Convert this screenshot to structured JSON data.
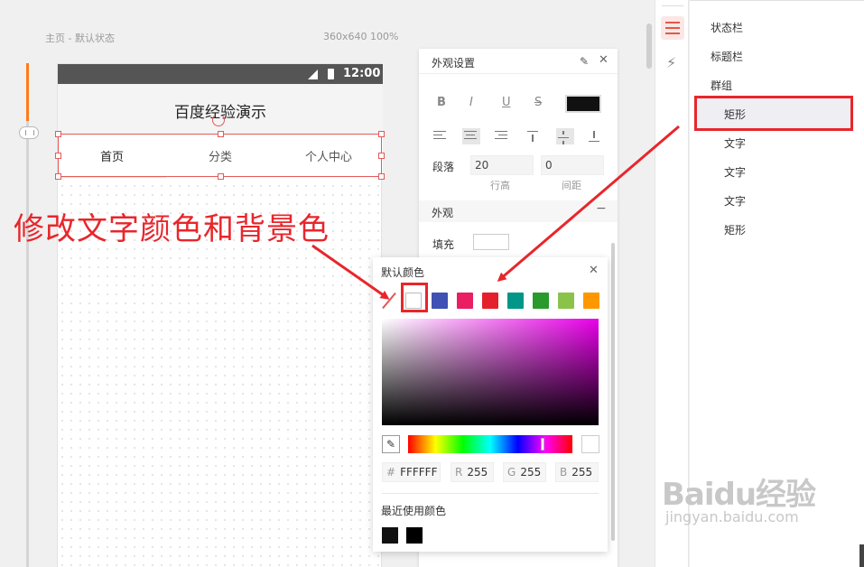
{
  "canvas": {
    "label": "主页 - 默认状态",
    "size_label": "360x640 100%"
  },
  "phone": {
    "status_time": "12:00",
    "title": "百度经验演示",
    "tabs": [
      "首页",
      "分类",
      "个人中心"
    ]
  },
  "annotation": "修改文字颜色和背景色",
  "properties": {
    "title": "外观设置",
    "format_buttons": [
      "B",
      "I",
      "U",
      "S"
    ],
    "line_height_label": "段落",
    "line_height_value": "20",
    "spacing_value": "0",
    "line_height_caption": "行高",
    "spacing_caption": "间距",
    "appearance_title": "外观",
    "collapse_symbol": "−",
    "fill_label": "填充",
    "text_color": "#111111"
  },
  "color_picker": {
    "title": "默认颜色",
    "presets": [
      "none",
      "#FFFFFF",
      "#3F51B5",
      "#E91E63",
      "#E5202D",
      "#009688",
      "#2A9A2D",
      "#8BC34A",
      "#FF9800"
    ],
    "hex_prefix": "#",
    "hex": "FFFFFF",
    "r_label": "R",
    "r": "255",
    "g_label": "G",
    "g": "255",
    "b_label": "B",
    "b": "255",
    "recent_title": "最近使用颜色",
    "recent_colors": [
      "#111111",
      "#000000"
    ]
  },
  "layers": {
    "items": [
      {
        "label": "状态栏",
        "indent": false
      },
      {
        "label": "标题栏",
        "indent": false
      },
      {
        "label": "群组",
        "indent": false
      },
      {
        "label": "矩形",
        "indent": true,
        "selected": true
      },
      {
        "label": "文字",
        "indent": true
      },
      {
        "label": "文字",
        "indent": true
      },
      {
        "label": "文字",
        "indent": true
      },
      {
        "label": "矩形",
        "indent": true
      }
    ]
  },
  "watermark": {
    "logo": "Baidu经验",
    "url": "jingyan.baidu.com"
  },
  "colors": {
    "accent_red": "#E8262B",
    "selection_red": "#E35A5A",
    "orange_rail": "#FF7A1A"
  }
}
